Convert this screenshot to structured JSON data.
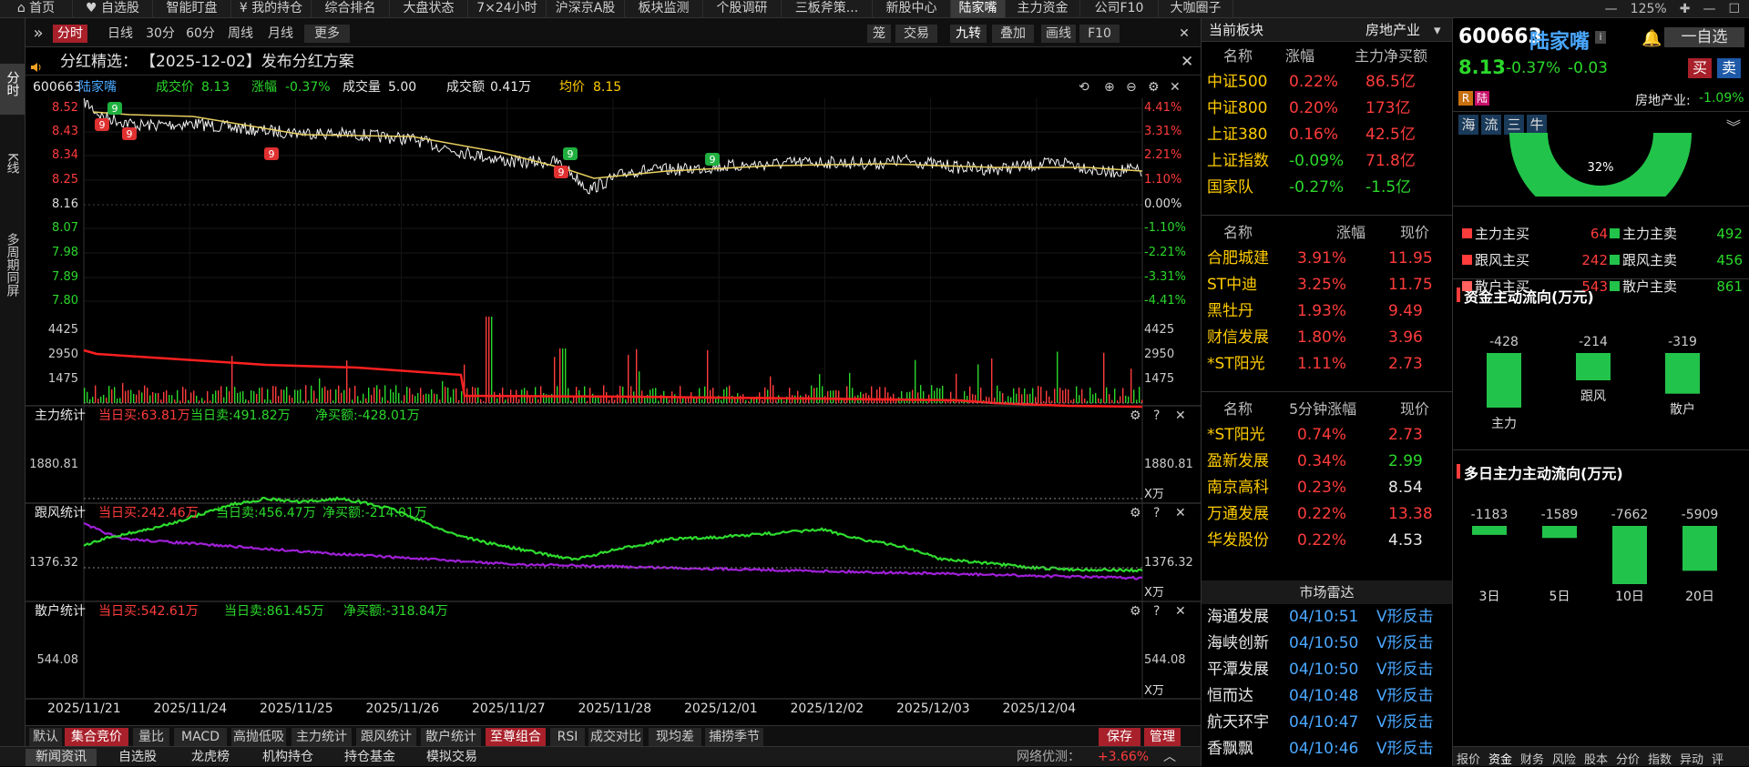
{
  "colors": {
    "up": "#ff3c3c",
    "down": "#2bd82b",
    "accent": "#a8202a",
    "mainline": "#ff2020",
    "followline": "#a020d8",
    "retailline": "#2edc2e"
  },
  "topnav": {
    "tabs": [
      "首页",
      "自选股",
      "智能盯盘",
      "我的持仓",
      "综合排名",
      "大盘状态",
      "7×24小时",
      "沪深京A股",
      "板块监测",
      "个股调研",
      "三板斧策...",
      "新股中心",
      "陆家嘴",
      "主力资金",
      "公司F10",
      "大咖圈子"
    ],
    "active": 12,
    "zoom": "125%",
    "icons": [
      "home-icon",
      "heart-icon",
      "yen-icon"
    ]
  },
  "leftbar": {
    "items": [
      "分时",
      "K线",
      "多周期同屏"
    ]
  },
  "toolbar": {
    "left": [
      "分时",
      "日线",
      "30分",
      "60分",
      "周线",
      "月线",
      "更多"
    ],
    "right": [
      "笼",
      "交易",
      "九转",
      "叠加",
      "画线",
      "F10"
    ]
  },
  "notice": {
    "label": "分红精选：",
    "text": "【2025-12-02】发布分红方案"
  },
  "info": {
    "code": "600663",
    "name": "陆家嘴",
    "price_label": "成交价",
    "price": "8.13",
    "change_label": "涨幅",
    "change": "-0.37%",
    "vol_label": "成交量",
    "vol": "5.00",
    "amt_label": "成交额",
    "amt": "0.41万",
    "avg_label": "均价",
    "avg": "8.15"
  },
  "price_axis": {
    "left": [
      "8.52",
      "8.43",
      "8.34",
      "8.25",
      "8.16",
      "8.07",
      "7.98",
      "7.89",
      "7.80"
    ],
    "right": [
      "4.41%",
      "3.31%",
      "2.21%",
      "1.10%",
      "0.00%",
      "-1.10%",
      "-2.21%",
      "-3.31%",
      "-4.41%"
    ]
  },
  "vol_axis": [
    "4425",
    "2950",
    "1475"
  ],
  "panels": [
    {
      "name": "主力统计",
      "buy": "当日买:63.81万",
      "sell": "当日卖:491.82万",
      "net": "净买额:-428.01万",
      "axis": "1880.81",
      "unit": "X万"
    },
    {
      "name": "跟风统计",
      "buy": "当日买:242.46万",
      "sell": "当日卖:456.47万",
      "net": "净买额:-214.01万",
      "axis": "1376.32",
      "unit": "X万"
    },
    {
      "name": "散户统计",
      "buy": "当日买:542.61万",
      "sell": "当日卖:861.45万",
      "net": "净买额:-318.84万",
      "axis": "544.08",
      "unit": "X万"
    }
  ],
  "dates": [
    "2025/11/21",
    "2025/11/24",
    "2025/11/25",
    "2025/11/26",
    "2025/11/27",
    "2025/11/28",
    "2025/12/01",
    "2025/12/02",
    "2025/12/03",
    "2025/12/04"
  ],
  "bottomtabs": [
    "默认",
    "集合竞价",
    "量比",
    "MACD",
    "高抛低吸",
    "主力统计",
    "跟风统计",
    "散户统计",
    "至尊组合",
    "RSI",
    "成交对比",
    "现均差",
    "捕捞季节",
    "保存",
    "管理"
  ],
  "bottombar": {
    "tabs": [
      "新闻资讯",
      "自选股",
      "龙虎榜",
      "机构持仓",
      "持仓基金",
      "模拟交易"
    ],
    "network": "网络优测：",
    "netval": "+3.66%"
  },
  "sector": {
    "title": "当前板块",
    "name": "房地产业",
    "h1": [
      "名称",
      "涨幅",
      "主力净买额"
    ],
    "idx": [
      [
        "中证500",
        "0.22%",
        "86.5亿"
      ],
      [
        "中证800",
        "0.20%",
        "173亿"
      ],
      [
        "上证380",
        "0.16%",
        "42.5亿"
      ],
      [
        "上证指数",
        "-0.09%",
        "71.8亿"
      ],
      [
        "国家队",
        "-0.27%",
        "-1.5亿"
      ]
    ],
    "h2": [
      "名称",
      "涨幅",
      "现价"
    ],
    "stk": [
      [
        "合肥城建",
        "3.91%",
        "11.95"
      ],
      [
        "ST中迪",
        "3.25%",
        "11.75"
      ],
      [
        "黑牡丹",
        "1.93%",
        "9.49"
      ],
      [
        "财信发展",
        "1.80%",
        "3.96"
      ],
      [
        "*ST阳光",
        "1.11%",
        "2.73"
      ]
    ],
    "h3": [
      "名称",
      "5分钟涨幅",
      "现价"
    ],
    "fast": [
      [
        "*ST阳光",
        "0.74%",
        "2.73"
      ],
      [
        "盈新发展",
        "0.34%",
        "2.99"
      ],
      [
        "南京高科",
        "0.23%",
        "8.54"
      ],
      [
        "万通发展",
        "0.22%",
        "13.38"
      ],
      [
        "华发股份",
        "0.22%",
        "4.53"
      ]
    ],
    "radar_title": "市场雷达",
    "radar": [
      [
        "海通发展",
        "04/10:51",
        "V形反击"
      ],
      [
        "海峡创新",
        "04/10:50",
        "V形反击"
      ],
      [
        "平潭发展",
        "04/10:50",
        "V形反击"
      ],
      [
        "恒而达",
        "04/10:48",
        "V形反击"
      ],
      [
        "航天环宇",
        "04/10:47",
        "V形反击"
      ],
      [
        "香飘飘",
        "04/10:46",
        "V形反击"
      ]
    ]
  },
  "stock": {
    "code": "600663",
    "name": "陆家嘴",
    "price": "8.13",
    "chg_pct": "-0.37%",
    "chg": "-0.03",
    "fav": "一自选",
    "buy": "买",
    "sell": "卖",
    "sector": "房地产业:",
    "sector_chg": "-1.09%",
    "tags": [
      "海",
      "流",
      "三",
      "牛"
    ],
    "badges": [
      "R",
      "陆"
    ],
    "pie_pct": "32%",
    "flows": [
      [
        "主力主买",
        "64",
        "主力主卖",
        "492"
      ],
      [
        "跟风主买",
        "242",
        "跟风主卖",
        "456"
      ],
      [
        "散户主买",
        "543",
        "散户主卖",
        "861"
      ]
    ],
    "flow_title": "资金主动流向(万元)",
    "flow_bars": [
      [
        "主力",
        "-428"
      ],
      [
        "跟风",
        "-214"
      ],
      [
        "散户",
        "-319"
      ]
    ],
    "multi_title": "多日主力主动流向(万元)",
    "multi_bars": [
      [
        "3日",
        "-1183"
      ],
      [
        "5日",
        "-1589"
      ],
      [
        "10日",
        "-7662"
      ],
      [
        "20日",
        "-5909"
      ]
    ],
    "bottom_tabs": [
      "报价",
      "资金",
      "财务",
      "风险",
      "股本",
      "分价",
      "指数",
      "异动",
      "评"
    ]
  }
}
